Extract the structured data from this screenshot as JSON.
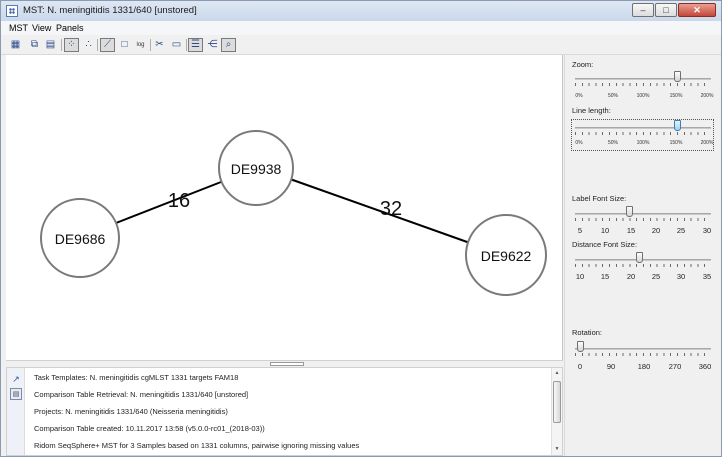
{
  "window": {
    "title": "MST: N. meningitidis 1331/640 [unstored]",
    "minimize_symbol": "–",
    "maximize_symbol": "□",
    "close_symbol": "✕"
  },
  "menu": {
    "items": [
      "MST",
      "View",
      "Panels"
    ]
  },
  "toolbar": {
    "icons": [
      "export-image-icon",
      "copy-icon",
      "layout-nodes-icon",
      "scatter-icon",
      "edge-tool-icon",
      "square-icon",
      "log-scale-icon",
      "scissors-icon",
      "label-icon",
      "list-icon",
      "tree-icon",
      "zoom-icon"
    ],
    "log_label": "log"
  },
  "graph": {
    "nodes": [
      {
        "label": "DE9686"
      },
      {
        "label": "DE9938"
      },
      {
        "label": "DE9622"
      }
    ],
    "edges": [
      {
        "from": "DE9686",
        "to": "DE9938",
        "distance": "16"
      },
      {
        "from": "DE9938",
        "to": "DE9622",
        "distance": "32"
      }
    ],
    "node_fill": "#ffffff",
    "node_stroke": "#7a7a7a"
  },
  "panel": {
    "zoom": {
      "label": "Zoom:",
      "ticks": [
        "0%",
        "50%",
        "100%",
        "150%",
        "200%"
      ],
      "value_percent": 150
    },
    "line_length": {
      "label": "Line length:",
      "ticks": [
        "0%",
        "50%",
        "100%",
        "150%",
        "200%"
      ],
      "value_percent": 150
    },
    "label_font_size": {
      "label": "Label Font Size:",
      "ticks": [
        "5",
        "10",
        "15",
        "20",
        "25",
        "30"
      ],
      "value": 15
    },
    "distance_font_size": {
      "label": "Distance Font Size:",
      "ticks": [
        "10",
        "15",
        "20",
        "25",
        "30",
        "35"
      ],
      "value": 22
    },
    "rotation": {
      "label": "Rotation:",
      "ticks": [
        "0",
        "90",
        "180",
        "270",
        "360"
      ],
      "value": 0
    }
  },
  "log": {
    "lines": [
      "Task Templates: N. meningitidis cgMLST 1331 targets FAM18",
      "Comparison Table Retrieval: N. meningitidis 1331/640 [unstored]",
      "Projects: N. meningitidis 1331/640 (Neisseria meningitidis)",
      "Comparison Table created: 10.11.2017 13:58 (v5.0.0-rc01_(2018-03))",
      "Ridom SeqSphere+ MST for 3 Samples based on 1331 columns, pairwise ignoring missing values"
    ]
  },
  "colors": {
    "accent": "#3c7fb1",
    "edge": "#000000"
  }
}
